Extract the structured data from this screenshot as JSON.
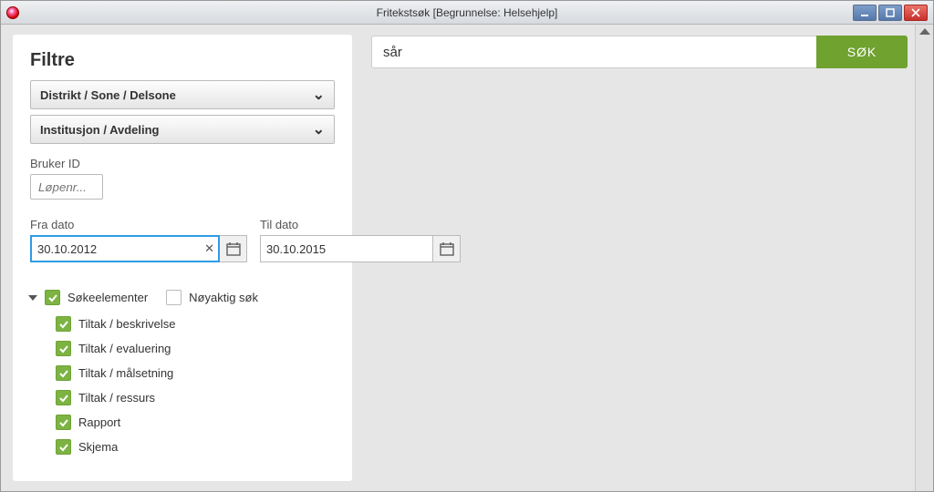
{
  "window": {
    "title": "Fritekstsøk  [Begrunnelse: Helsehjelp]"
  },
  "filters": {
    "heading": "Filtre",
    "accordion1": "Distrikt / Sone / Delsone",
    "accordion2": "Institusjon / Avdeling",
    "user_id_label": "Bruker ID",
    "user_id_placeholder": "Løpenr...",
    "from_date_label": "Fra dato",
    "from_date_value": "30.10.2012",
    "to_date_label": "Til dato",
    "to_date_value": "30.10.2015",
    "search_elements_label": "Søkeelementer",
    "exact_search_label": "Nøyaktig søk",
    "items": {
      "tiltak_beskrivelse": "Tiltak / beskrivelse",
      "tiltak_evaluering": "Tiltak / evaluering",
      "tiltak_malsetning": "Tiltak / målsetning",
      "tiltak_ressurs": "Tiltak / ressurs",
      "rapport": "Rapport",
      "skjema": "Skjema"
    }
  },
  "search": {
    "value": "sår",
    "button": "SØK"
  }
}
